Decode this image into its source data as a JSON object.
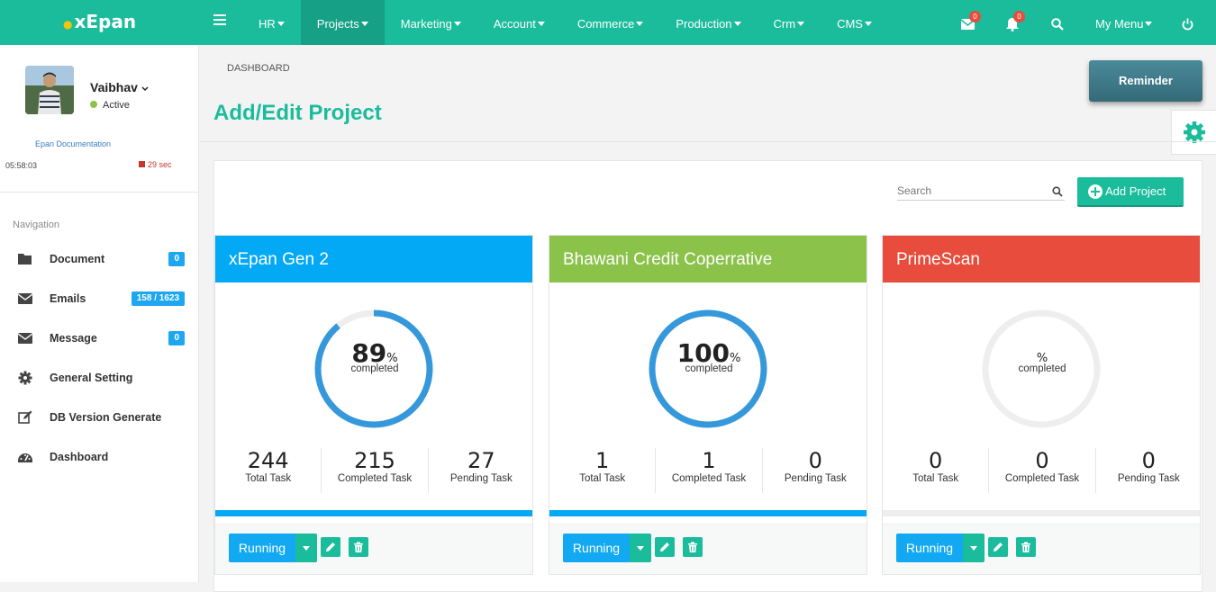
{
  "brand": "xEpan",
  "nav": {
    "items": [
      {
        "label": "HR",
        "active": false
      },
      {
        "label": "Projects",
        "active": true
      },
      {
        "label": "Marketing",
        "active": false
      },
      {
        "label": "Account",
        "active": false
      },
      {
        "label": "Commerce",
        "active": false
      },
      {
        "label": "Production",
        "active": false
      },
      {
        "label": "Crm",
        "active": false
      },
      {
        "label": "CMS",
        "active": false
      }
    ],
    "mail_badge": "0",
    "bell_badge": "0",
    "mymenu": "My Menu"
  },
  "user": {
    "name": "Vaibhav",
    "status": "Active",
    "doc_link": "Epan Documentation",
    "timer": "05:58:03",
    "seconds": "29 sec"
  },
  "sidebar": {
    "heading": "Navigation",
    "items": [
      {
        "label": "Document",
        "badge": "0",
        "icon": "folder-icon"
      },
      {
        "label": "Emails",
        "badge": "158 / 1623",
        "icon": "envelope-icon"
      },
      {
        "label": "Message",
        "badge": "0",
        "icon": "envelope-icon"
      },
      {
        "label": "General Setting",
        "badge": "",
        "icon": "gear-icon"
      },
      {
        "label": "DB Version Generate",
        "badge": "",
        "icon": "edit-icon"
      },
      {
        "label": "Dashboard",
        "badge": "",
        "icon": "dashboard-icon"
      }
    ]
  },
  "breadcrumb": "DASHBOARD",
  "page_title": "Add/Edit Project",
  "reminder": "Reminder",
  "search": {
    "placeholder": "Search"
  },
  "add_button": "Add Project",
  "colors": {
    "accent": "#1abc9c",
    "blue": "#03a9f4",
    "green": "#8bc34a",
    "red": "#e74c3c"
  },
  "projects": [
    {
      "name": "xEpan Gen 2",
      "color": "#03a9f4",
      "percent": "89",
      "percent_value": 89,
      "pct_sign": "%",
      "completed_label": "completed",
      "total": "244",
      "completed": "215",
      "pending": "27",
      "total_label": "Total Task",
      "completed_task_label": "Completed Task",
      "pending_label": "Pending Task",
      "progress_fraction": 1.0,
      "status": "Running"
    },
    {
      "name": "Bhawani Credit Coperrative",
      "color": "#8bc34a",
      "percent": "100",
      "percent_value": 100,
      "pct_sign": "%",
      "completed_label": "completed",
      "total": "1",
      "completed": "1",
      "pending": "0",
      "total_label": "Total Task",
      "completed_task_label": "Completed Task",
      "pending_label": "Pending Task",
      "progress_fraction": 1.0,
      "status": "Running"
    },
    {
      "name": "PrimeScan",
      "color": "#e74c3c",
      "percent": "",
      "percent_value": 0,
      "pct_sign": "%",
      "completed_label": "completed",
      "total": "0",
      "completed": "0",
      "pending": "0",
      "total_label": "Total Task",
      "completed_task_label": "Completed Task",
      "pending_label": "Pending Task",
      "progress_fraction": 0.0,
      "status": "Running"
    }
  ]
}
